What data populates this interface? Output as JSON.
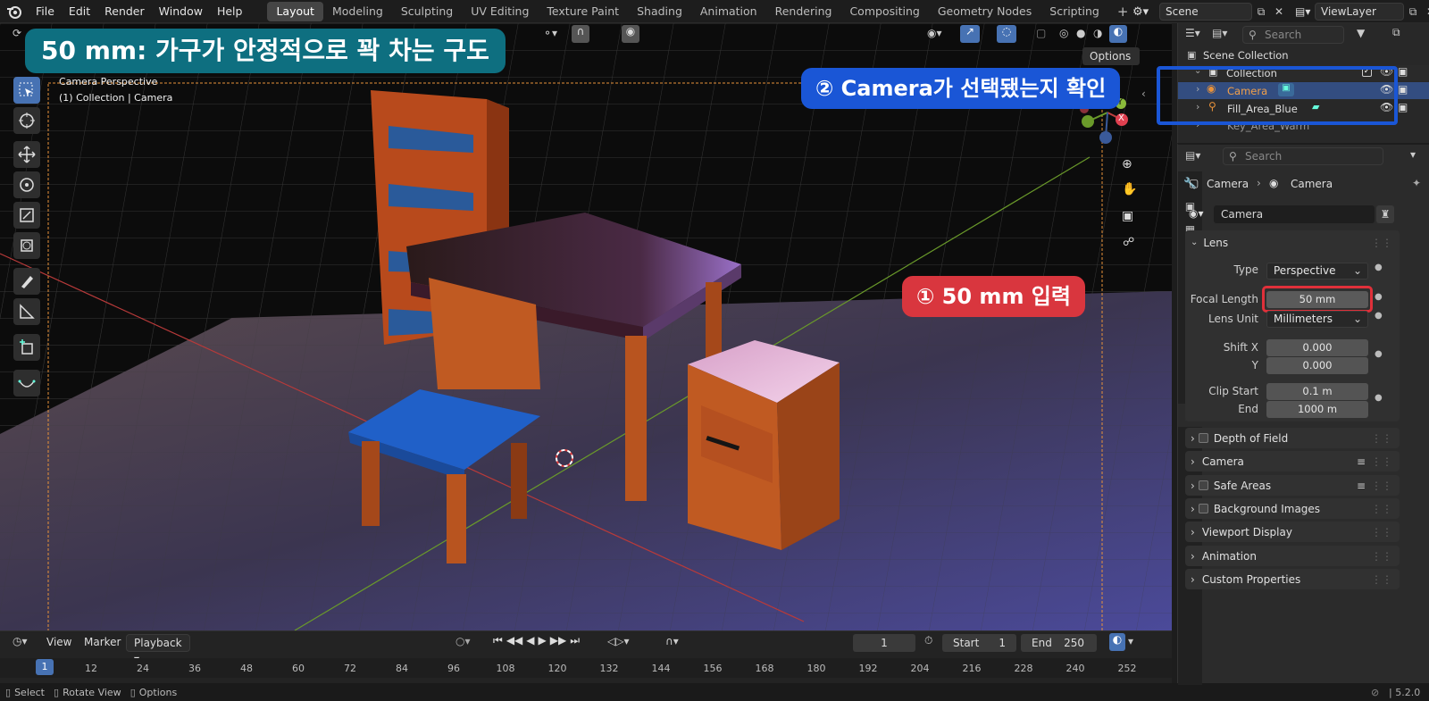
{
  "topbar": {
    "menus": [
      "File",
      "Edit",
      "Render",
      "Window",
      "Help"
    ],
    "workspaces": [
      "Layout",
      "Modeling",
      "Sculpting",
      "UV Editing",
      "Texture Paint",
      "Shading",
      "Animation",
      "Rendering",
      "Compositing",
      "Geometry Nodes",
      "Scripting"
    ],
    "active_workspace": "Layout",
    "add_tab": "+",
    "scene": "Scene",
    "view_layer": "ViewLayer"
  },
  "viewport": {
    "overlay_title": "Camera Perspective",
    "overlay_subtitle": "(1) Collection | Camera",
    "options_label": "Options",
    "callout_top": "50 mm: 가구가 안정적으로 꽉 차는 구도",
    "callout_select": "② Camera가 선택됐는지 확인",
    "callout_focal": "① 50 mm 입력",
    "gizmo_axes": [
      "X",
      "Y",
      "Z"
    ]
  },
  "outliner": {
    "search_placeholder": "Search",
    "root": "Scene Collection",
    "collection": "Collection",
    "items": [
      "Camera",
      "Fill_Area_Blue",
      "Key_Area_Warm"
    ]
  },
  "properties": {
    "search_placeholder": "Search",
    "breadcrumb": [
      "Camera",
      "Camera"
    ],
    "datablock": "Camera",
    "lens_panel": "Lens",
    "type_label": "Type",
    "type_value": "Perspective",
    "focal_label": "Focal Length",
    "focal_value": "50 mm",
    "lens_unit_label": "Lens Unit",
    "lens_unit_value": "Millimeters",
    "shift_x_label": "Shift X",
    "shift_x_value": "0.000",
    "shift_y_label": "Y",
    "shift_y_value": "0.000",
    "clip_start_label": "Clip Start",
    "clip_start_value": "0.1 m",
    "clip_end_label": "End",
    "clip_end_value": "1000 m",
    "panels": [
      "Depth of Field",
      "Camera",
      "Safe Areas",
      "Background Images",
      "Viewport Display",
      "Animation",
      "Custom Properties"
    ]
  },
  "timeline": {
    "menus": [
      "View",
      "Marker",
      "Playback"
    ],
    "current_frame": "1",
    "start_label": "Start",
    "start_value": "1",
    "end_label": "End",
    "end_value": "250",
    "frames": [
      "1",
      "12",
      "24",
      "36",
      "48",
      "60",
      "72",
      "84",
      "96",
      "108",
      "120",
      "132",
      "144",
      "156",
      "168",
      "180",
      "192",
      "204",
      "216",
      "228",
      "240",
      "252"
    ]
  },
  "statusbar": {
    "select": "Select",
    "rotate": "Rotate View",
    "options": "Options",
    "version": "5.2.0"
  },
  "colors": {
    "accent_blue": "#4772b3",
    "callout_teal": "#0e6f80",
    "callout_blue": "#1a56d6",
    "callout_red": "#d9363e",
    "camera_orange": "#e8923a"
  }
}
